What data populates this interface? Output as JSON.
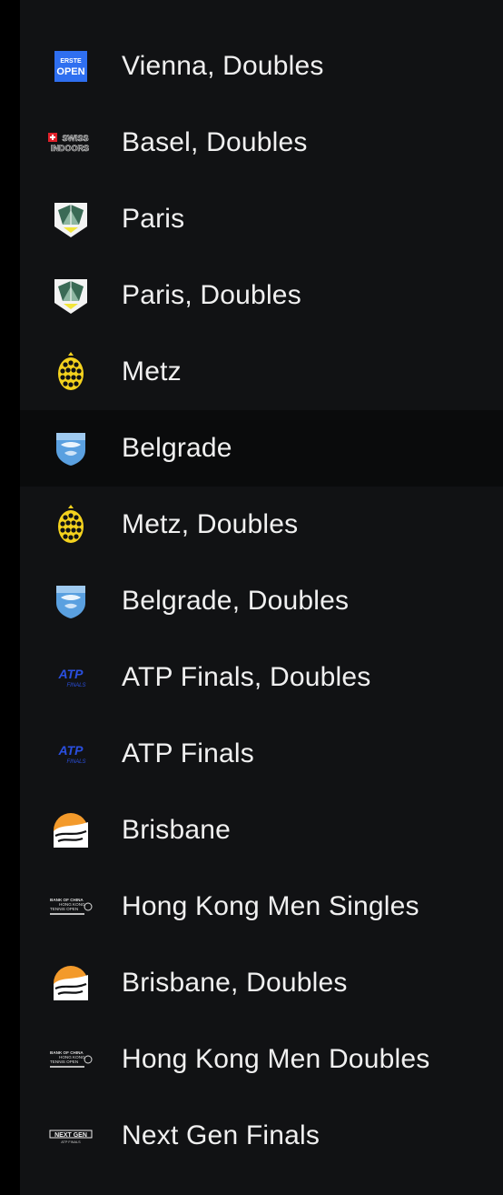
{
  "tournaments": [
    {
      "name": "Vienna, Doubles",
      "logo": "erste-open-logo",
      "logo_text": [
        "ERSTE",
        "OPEN"
      ]
    },
    {
      "name": "Basel, Doubles",
      "logo": "swiss-indoors-logo",
      "logo_text": [
        "SWISS",
        "INDOORS"
      ]
    },
    {
      "name": "Paris",
      "logo": "paris-masters-logo"
    },
    {
      "name": "Paris, Doubles",
      "logo": "paris-masters-logo"
    },
    {
      "name": "Metz",
      "logo": "metz-logo"
    },
    {
      "name": "Belgrade",
      "logo": "belgrade-logo",
      "selected": true
    },
    {
      "name": "Metz, Doubles",
      "logo": "metz-logo"
    },
    {
      "name": "Belgrade, Doubles",
      "logo": "belgrade-logo"
    },
    {
      "name": "ATP Finals, Doubles",
      "logo": "atp-finals-logo",
      "logo_text": [
        "ATP",
        "FINALS"
      ]
    },
    {
      "name": "ATP Finals",
      "logo": "atp-finals-logo",
      "logo_text": [
        "ATP",
        "FINALS"
      ]
    },
    {
      "name": "Brisbane",
      "logo": "brisbane-logo"
    },
    {
      "name": "Hong Kong Men Singles",
      "logo": "hong-kong-open-logo",
      "logo_text": [
        "BANK OF CHINA",
        "HONG KONG",
        "TENNIS OPEN"
      ]
    },
    {
      "name": "Brisbane, Doubles",
      "logo": "brisbane-logo"
    },
    {
      "name": "Hong Kong Men Doubles",
      "logo": "hong-kong-open-logo",
      "logo_text": [
        "BANK OF CHINA",
        "HONG KONG",
        "TENNIS OPEN"
      ]
    },
    {
      "name": "Next Gen Finals",
      "logo": "next-gen-finals-logo",
      "logo_text": [
        "NEXT GEN",
        "ATP FINALS"
      ]
    }
  ],
  "colors": {
    "background": "#111214",
    "selected_row": "#0a0b0c",
    "text": "#f0f0f0",
    "erste_blue": "#2f6ff0",
    "metz_yellow": "#f4d21e",
    "brisbane_orange": "#f39a2b",
    "atp_blue": "#2a4fe0"
  }
}
